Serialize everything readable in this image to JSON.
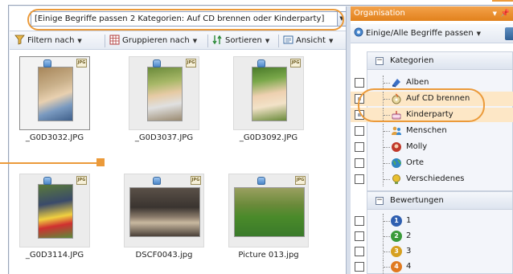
{
  "filter": {
    "text": "[Einige Begriffe passen 2 Kategorien: Auf CD brennen oder Kinderparty]"
  },
  "toolbar": {
    "filter_label": "Filtern nach",
    "group_label": "Gruppieren nach",
    "sort_label": "Sortieren",
    "view_label": "Ansicht"
  },
  "thumbnails": [
    {
      "name": "_G0D3032.JPG",
      "selected": true
    },
    {
      "name": "_G0D3037.JPG",
      "selected": false
    },
    {
      "name": "_G0D3092.JPG",
      "selected": false
    },
    {
      "name": "_G0D3114.JPG",
      "selected": false
    },
    {
      "name": "DSCF0043.jpg",
      "selected": false
    },
    {
      "name": "Picture 013.jpg",
      "selected": false
    }
  ],
  "badge": "JPG",
  "organisation": {
    "title": "Organisation",
    "match_label": "Einige/Alle Begriffe passen",
    "categories_header": "Kategorien",
    "categories": [
      {
        "label": "Alben",
        "icon": "album-icon",
        "state": "unchecked",
        "color": "#3b6fc4"
      },
      {
        "label": "Auf CD brennen",
        "icon": "cd-burn-icon",
        "state": "mixed",
        "color": "#c9a64a"
      },
      {
        "label": "Kinderparty",
        "icon": "cake-icon",
        "state": "mixed",
        "color": "#d07aa8"
      },
      {
        "label": "Menschen",
        "icon": "people-icon",
        "state": "unchecked",
        "color": "#e0a040"
      },
      {
        "label": "Molly",
        "icon": "person-icon",
        "state": "unchecked",
        "color": "#c0392b"
      },
      {
        "label": "Orte",
        "icon": "globe-icon",
        "state": "unchecked",
        "color": "#2e86c1"
      },
      {
        "label": "Verschiedenes",
        "icon": "lightbulb-icon",
        "state": "unchecked",
        "color": "#e8c030"
      }
    ],
    "ratings_header": "Bewertungen",
    "ratings": [
      {
        "label": "1",
        "color": "#2f5fb0"
      },
      {
        "label": "2",
        "color": "#3a9a3a"
      },
      {
        "label": "3",
        "color": "#d6a020"
      },
      {
        "label": "4",
        "color": "#e07a20"
      }
    ]
  },
  "colors": {
    "highlight": "#eb9a3a",
    "header_orange": "#e2811c"
  }
}
